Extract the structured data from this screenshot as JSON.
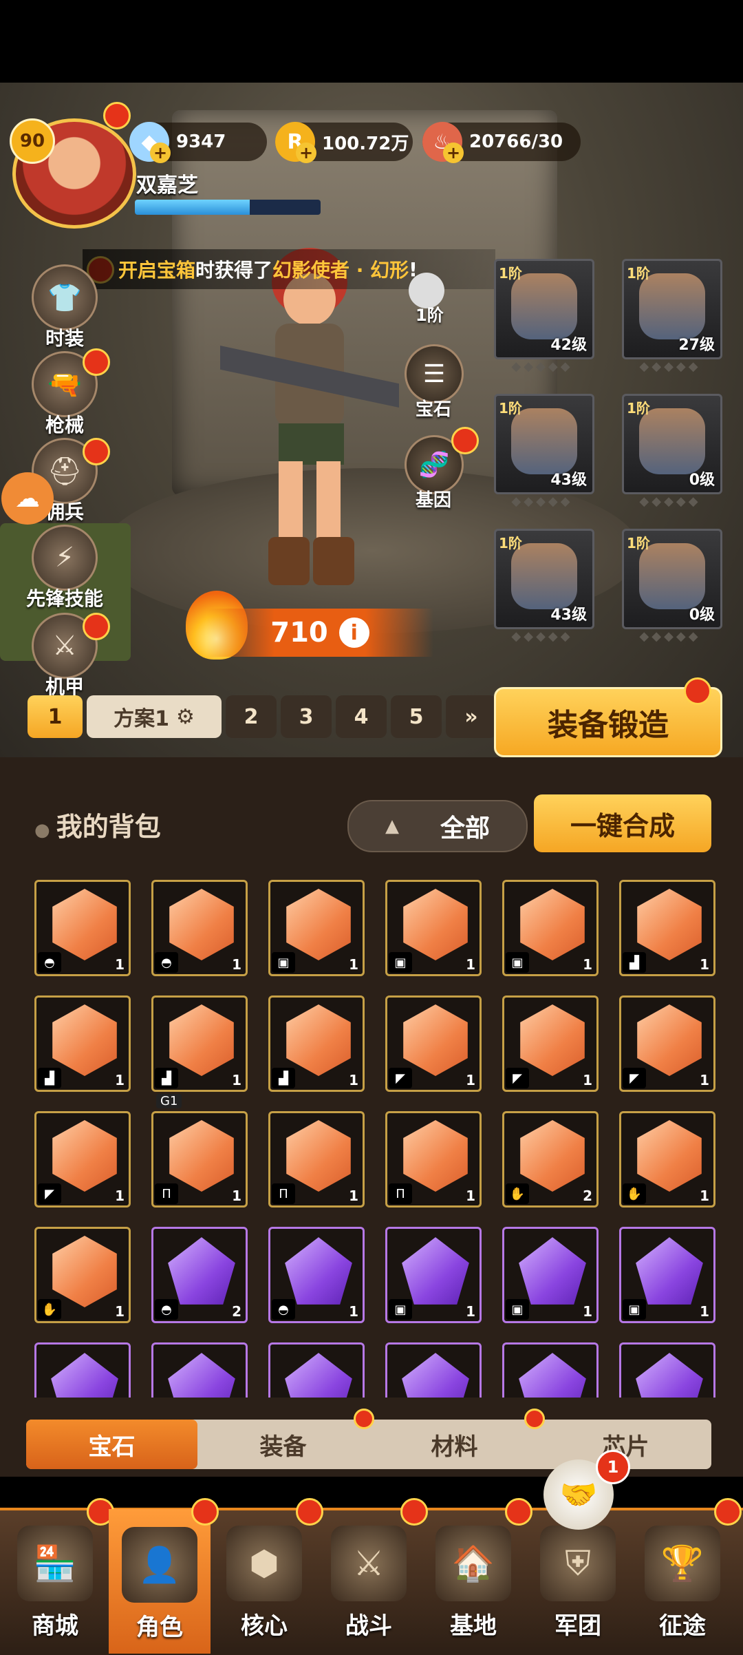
{
  "player": {
    "level": "90",
    "name": "双嘉芝",
    "xp_fraction": 0.62
  },
  "currencies": [
    {
      "icon": "diamond-icon",
      "value": "9347",
      "color": "#7fc8ff"
    },
    {
      "icon": "coin-icon",
      "symbol": "R",
      "value": "100.72万",
      "color": "#f5b21c"
    },
    {
      "icon": "meat-icon",
      "value": "20766/30",
      "color": "#e0664a"
    }
  ],
  "notice": {
    "prefix": "开启宝箱",
    "middle": "时获得了",
    "item": "幻影使者 · 幻形",
    "suffix": "!"
  },
  "left_menu": [
    {
      "label": "时装",
      "icon": "costume-icon"
    },
    {
      "label": "枪械",
      "icon": "gun-icon"
    },
    {
      "label": "佣兵",
      "icon": "mercenary-icon"
    },
    {
      "label": "先锋技能",
      "icon": "skill-icon"
    },
    {
      "label": "机甲",
      "icon": "mech-icon"
    }
  ],
  "mid_buttons": {
    "tier": "1阶",
    "gem": "宝石",
    "gene": "基因"
  },
  "equipment": [
    {
      "tier": "1阶",
      "level": "42级",
      "slot": "helmet"
    },
    {
      "tier": "1阶",
      "level": "27级",
      "slot": "bracer"
    },
    {
      "tier": "1阶",
      "level": "43级",
      "slot": "armor"
    },
    {
      "tier": "1阶",
      "level": "0级",
      "slot": "pants"
    },
    {
      "tier": "1阶",
      "level": "43级",
      "slot": "boots"
    },
    {
      "tier": "1阶",
      "level": "0级",
      "slot": "gloves"
    }
  ],
  "power": "710",
  "presets": {
    "active": "1",
    "name": "方案1",
    "others": [
      "2",
      "3",
      "4",
      "5"
    ],
    "more": "»"
  },
  "forge_label": "装备锻造",
  "bag": {
    "title": "我的背包",
    "filter": "全部",
    "merge": "一键合成",
    "items": [
      {
        "q": "orange",
        "t": "◓",
        "c": "1"
      },
      {
        "q": "orange",
        "t": "◓",
        "c": "1"
      },
      {
        "q": "orange",
        "t": "▣",
        "c": "1"
      },
      {
        "q": "orange",
        "t": "▣",
        "c": "1"
      },
      {
        "q": "orange",
        "t": "▣",
        "c": "1"
      },
      {
        "q": "orange",
        "t": "▟",
        "c": "1"
      },
      {
        "q": "orange",
        "t": "▟",
        "c": "1"
      },
      {
        "q": "orange",
        "t": "▟",
        "c": "1"
      },
      {
        "q": "orange",
        "t": "▟",
        "c": "1"
      },
      {
        "q": "orange",
        "t": "◤",
        "c": "1"
      },
      {
        "q": "orange",
        "t": "◤",
        "c": "1"
      },
      {
        "q": "orange",
        "t": "◤",
        "c": "1"
      },
      {
        "q": "orange",
        "t": "◤",
        "c": "1"
      },
      {
        "q": "orange",
        "t": "Π",
        "c": "1",
        "tag": "G1"
      },
      {
        "q": "orange",
        "t": "Π",
        "c": "1"
      },
      {
        "q": "orange",
        "t": "Π",
        "c": "1"
      },
      {
        "q": "orange",
        "t": "✋",
        "c": "2"
      },
      {
        "q": "orange",
        "t": "✋",
        "c": "1"
      },
      {
        "q": "orange",
        "t": "✋",
        "c": "1"
      },
      {
        "q": "purple",
        "t": "◓",
        "c": "2"
      },
      {
        "q": "purple",
        "t": "◓",
        "c": "1"
      },
      {
        "q": "purple",
        "t": "▣",
        "c": "1"
      },
      {
        "q": "purple",
        "t": "▣",
        "c": "1"
      },
      {
        "q": "purple",
        "t": "▣",
        "c": "1"
      },
      {
        "q": "purple",
        "t": "",
        "c": ""
      },
      {
        "q": "purple",
        "t": "",
        "c": ""
      },
      {
        "q": "purple",
        "t": "",
        "c": ""
      },
      {
        "q": "purple",
        "t": "",
        "c": ""
      },
      {
        "q": "purple",
        "t": "",
        "c": ""
      },
      {
        "q": "purple",
        "t": "",
        "c": ""
      }
    ]
  },
  "tabs": [
    "宝石",
    "装备",
    "材料",
    "芯片"
  ],
  "alliance_badge": "1",
  "bottom_nav": [
    {
      "label": "商城",
      "icon": "shop-icon"
    },
    {
      "label": "角色",
      "icon": "character-icon"
    },
    {
      "label": "核心",
      "icon": "core-icon"
    },
    {
      "label": "战斗",
      "icon": "battle-icon"
    },
    {
      "label": "基地",
      "icon": "base-icon"
    },
    {
      "label": "军团",
      "icon": "legion-icon"
    },
    {
      "label": "征途",
      "icon": "journey-icon"
    }
  ]
}
